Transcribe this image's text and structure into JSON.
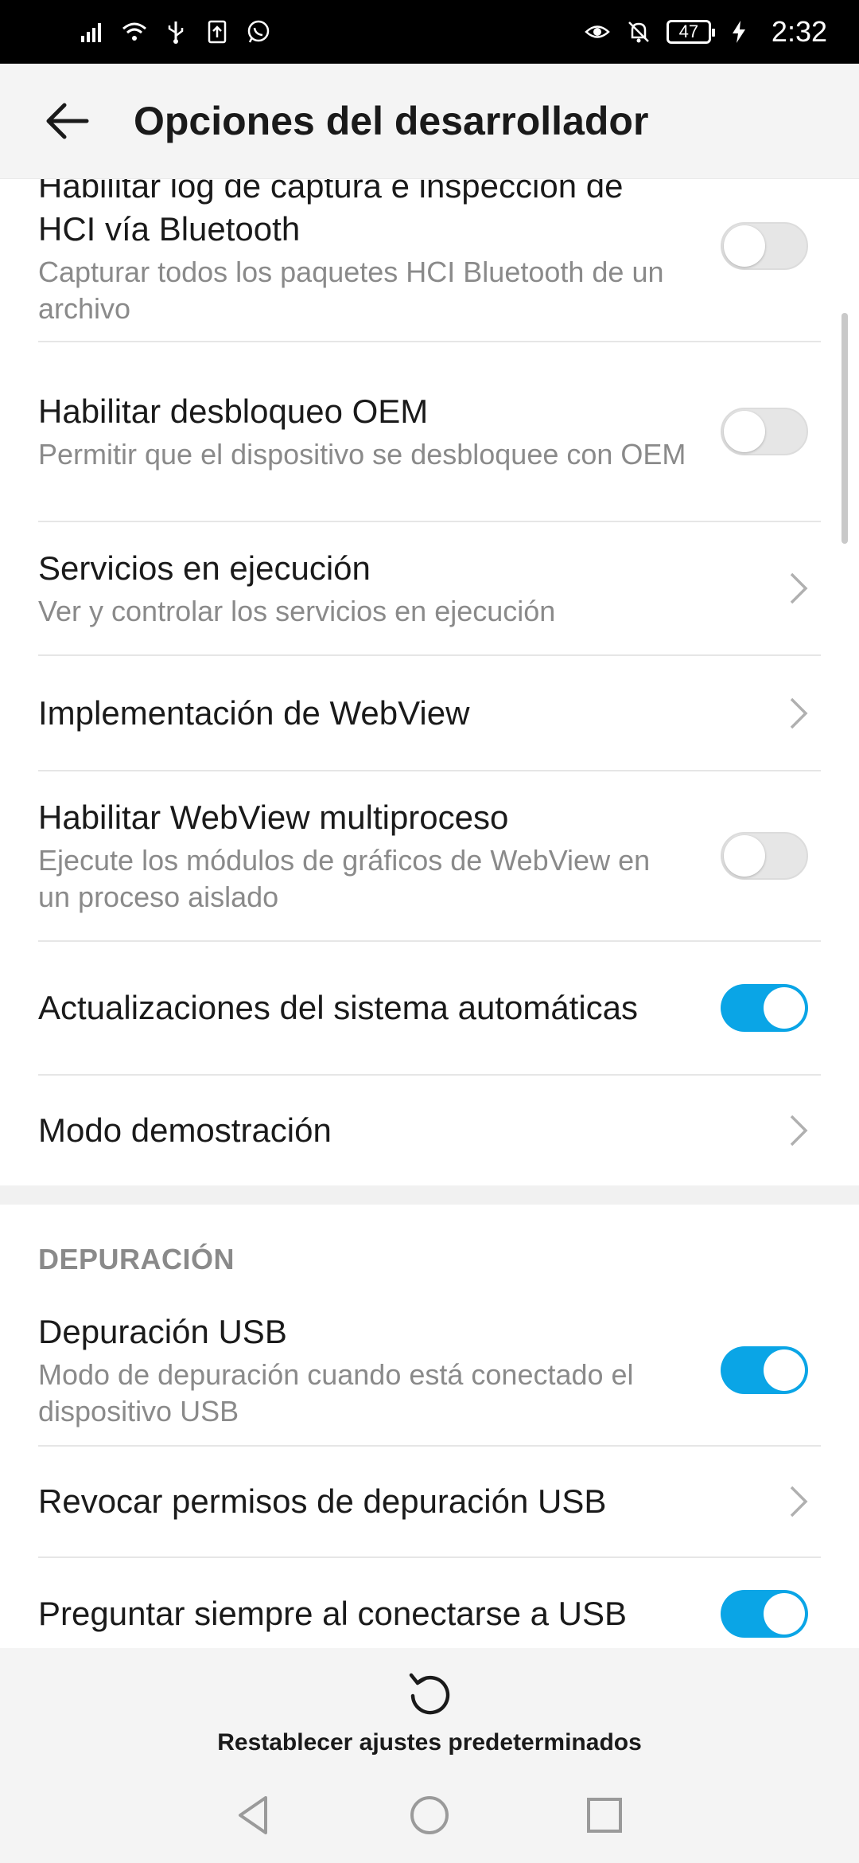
{
  "status_bar": {
    "battery_level": "47",
    "time": "2:32",
    "icons_left": [
      "signal-icon",
      "wifi-icon",
      "usb-icon",
      "upload-icon",
      "whatsapp-icon"
    ],
    "icons_right": [
      "eye-comfort-icon",
      "mute-bell-icon",
      "battery-icon",
      "charging-icon"
    ]
  },
  "header": {
    "title": "Opciones del desarrollador"
  },
  "settings": [
    {
      "title": "Habilitar log de captura e inspección de HCI vía Bluetooth",
      "subtitle": "Capturar todos los paquetes HCI Bluetooth de un archivo",
      "control": "toggle",
      "checked": false
    },
    {
      "title": "Habilitar desbloqueo OEM",
      "subtitle": "Permitir que el dispositivo se desbloquee con OEM",
      "control": "toggle",
      "checked": false
    },
    {
      "title": "Servicios en ejecución",
      "subtitle": "Ver y controlar los servicios en ejecución",
      "control": "chevron"
    },
    {
      "title": "Implementación de WebView",
      "control": "chevron"
    },
    {
      "title": "Habilitar WebView multiproceso",
      "subtitle": "Ejecute los módulos de gráficos de WebView en un proceso aislado",
      "control": "toggle",
      "checked": false
    },
    {
      "title": "Actualizaciones del sistema automáticas",
      "control": "toggle",
      "checked": true
    },
    {
      "title": "Modo demostración",
      "control": "chevron"
    }
  ],
  "debug_section": {
    "header": "DEPURACIÓN",
    "items": [
      {
        "title": "Depuración USB",
        "subtitle": "Modo de depuración cuando está conectado el dispositivo USB",
        "control": "toggle",
        "checked": true
      },
      {
        "title": "Revocar permisos de depuración USB",
        "control": "chevron"
      },
      {
        "title": "Preguntar siempre al conectarse a USB",
        "control": "toggle",
        "checked": true
      }
    ]
  },
  "footer": {
    "reset_label": "Restablecer ajustes predeterminados"
  },
  "colors": {
    "accent": "#0aa5e6",
    "toggle_off": "#e6e6e6",
    "secondary_text": "#8a8a8a"
  }
}
